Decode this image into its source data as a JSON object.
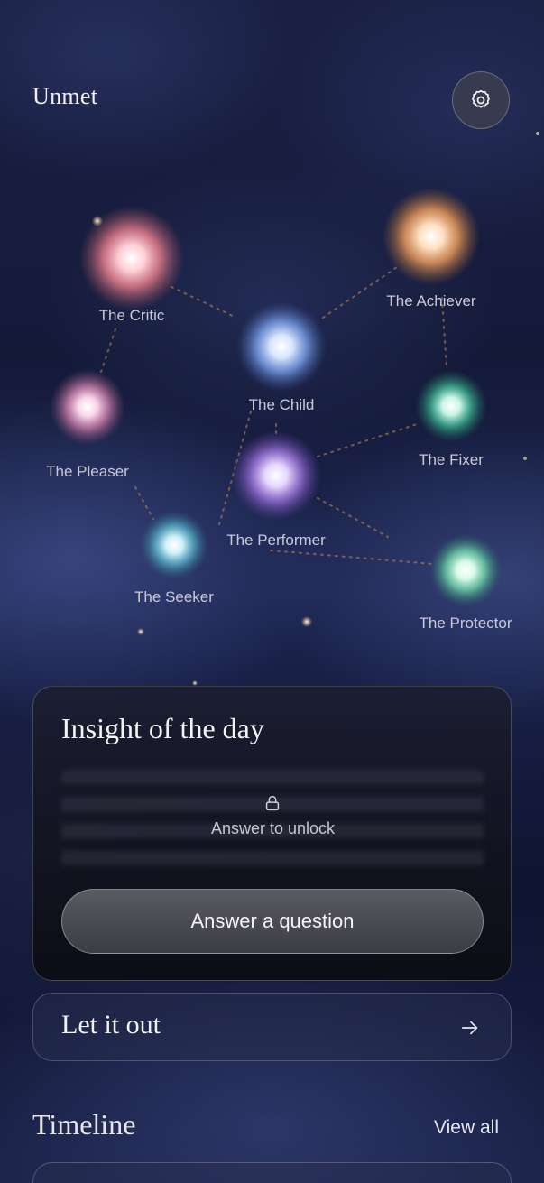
{
  "header": {
    "app_title": "Unmet",
    "settings_icon": "gear-icon"
  },
  "constellation": {
    "stars": [
      {
        "id": "critic",
        "label": "The Critic",
        "color": "#ff8a9a"
      },
      {
        "id": "achiever",
        "label": "The Achiever",
        "color": "#ffb070"
      },
      {
        "id": "child",
        "label": "The Child",
        "color": "#8fb8ff"
      },
      {
        "id": "pleaser",
        "label": "The Pleaser",
        "color": "#f09ac8"
      },
      {
        "id": "fixer",
        "label": "The Fixer",
        "color": "#5ed6b8"
      },
      {
        "id": "performer",
        "label": "The Performer",
        "color": "#c49aff"
      },
      {
        "id": "seeker",
        "label": "The Seeker",
        "color": "#7fd0e6"
      },
      {
        "id": "protector",
        "label": "The Protector",
        "color": "#8ff0c8"
      }
    ]
  },
  "insight": {
    "title": "Insight of the day",
    "lock_icon": "lock-icon",
    "unlock_text": "Answer to unlock",
    "button_label": "Answer a question"
  },
  "let_it_out": {
    "label": "Let it out",
    "arrow_icon": "arrow-right-icon"
  },
  "timeline": {
    "title": "Timeline",
    "view_all": "View all"
  }
}
